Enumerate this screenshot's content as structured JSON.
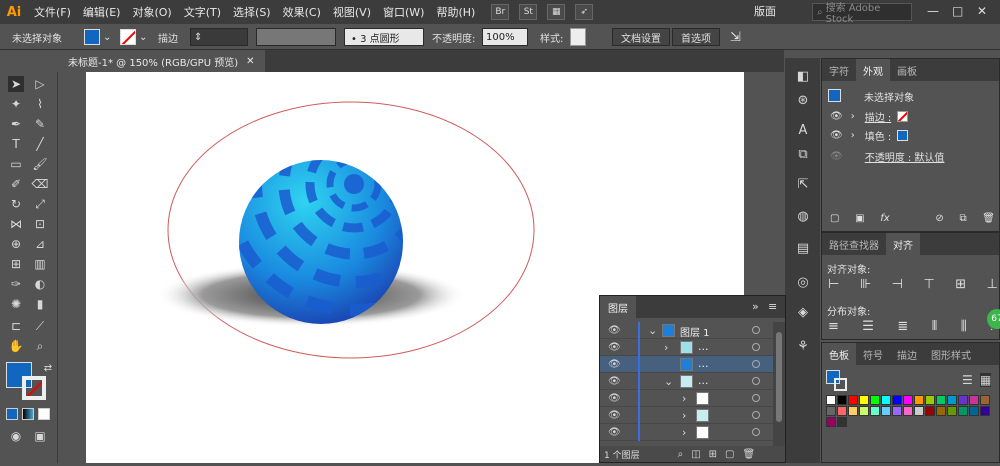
{
  "app": {
    "logo": "Ai"
  },
  "menu": [
    "文件(F)",
    "编辑(E)",
    "对象(O)",
    "文字(T)",
    "选择(S)",
    "效果(C)",
    "视图(V)",
    "窗口(W)",
    "帮助(H)"
  ],
  "menu_buttons": [
    "Br",
    "St"
  ],
  "workspace": "版面",
  "stock_search": {
    "placeholder": "搜索 Adobe Stock"
  },
  "window_controls": [
    "—",
    "□",
    "✕"
  ],
  "control_bar": {
    "no_selection": "未选择对象",
    "stroke_label": "描边",
    "brush_label": "• 3 点圆形",
    "opacity_label": "不透明度:",
    "opacity_value": "100%",
    "style_label": "样式:",
    "doc_setup": "文档设置",
    "preferences": "首选项",
    "fill_color": "#1166c0"
  },
  "document_tab": {
    "title": "未标题-1* @ 150% (RGB/GPU 预览)",
    "close": "✕"
  },
  "appearance_panel": {
    "tabs": [
      "字符",
      "外观",
      "画板"
    ],
    "active_tab": "外观",
    "header": "未选择对象",
    "stroke_row": "描边 :",
    "fill_row": "填色 :",
    "opacity_row": "不透明度 : 默认值",
    "footer_icons": [
      "new-square-icon",
      "clear-icon",
      "fx-icon",
      "delete-icon"
    ]
  },
  "align_panel": {
    "tabs": [
      "路径查找器",
      "对齐"
    ],
    "active_tab": "对齐",
    "align_label": "对齐对象:",
    "distribute_label": "分布对象:",
    "badge": "67"
  },
  "swatches_panel": {
    "tabs": [
      "色板",
      "符号",
      "描边",
      "图形样式"
    ],
    "active_tab": "色板",
    "colors": [
      "#ffffff",
      "#000000",
      "#ff0000",
      "#ffff00",
      "#00ff00",
      "#00ffff",
      "#0000ff",
      "#ff00ff",
      "#ff9900",
      "#99cc00",
      "#00cc66",
      "#0099cc",
      "#6633cc",
      "#cc3399",
      "#996633",
      "#666666",
      "#ff6666",
      "#ffcc66",
      "#ccff66",
      "#66ffcc",
      "#66ccff",
      "#9966ff",
      "#ff66cc",
      "#cccccc",
      "#990000",
      "#996600",
      "#669900",
      "#009966",
      "#006699",
      "#330099",
      "#990066",
      "#333333"
    ]
  },
  "layers_panel": {
    "title": "图层",
    "menu": "≡",
    "expand": "»",
    "layer_name": "图层 1",
    "sub_items": [
      "...",
      "...",
      "..."
    ],
    "footer": "1 个图层"
  }
}
